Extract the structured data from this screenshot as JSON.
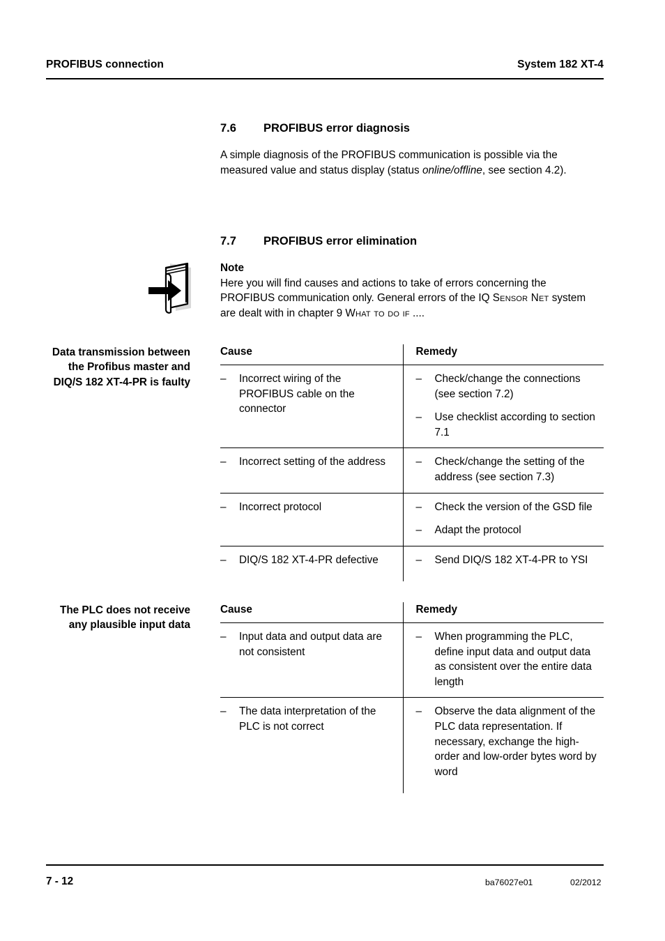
{
  "header": {
    "left": "PROFIBUS connection",
    "right": "System 182 XT-4"
  },
  "sections": {
    "s76": {
      "number": "7.6",
      "title": "PROFIBUS error diagnosis",
      "body_1": "A simple diagnosis of the PROFIBUS communication is possible via the measured value and status display (status ",
      "body_em": "online/offline",
      "body_2": ", see section 4.2)."
    },
    "s77": {
      "number": "7.7",
      "title": "PROFIBUS error elimination"
    }
  },
  "note": {
    "icon": "book-arrow-icon",
    "title": "Note",
    "text_1": "Here you will find causes and actions to take of errors concerning the PROFIBUS communication only. General errors of the IQ ",
    "smallcaps_1": "Sensor Net",
    "text_2": " system are dealt with in chapter 9 ",
    "smallcaps_2": "What to do if",
    "text_3": " ...."
  },
  "tables": [
    {
      "margin_label": "Data transmission between the Profibus master and DIQ/S 182 XT-4-PR is faulty",
      "headers": [
        "Cause",
        "Remedy"
      ],
      "rows": [
        {
          "cause": [
            "Incorrect wiring of the PROFIBUS cable on the connector"
          ],
          "remedy": [
            "Check/change the connections (see section 7.2)",
            "Use checklist according to section 7.1"
          ]
        },
        {
          "cause": [
            "Incorrect setting of the address"
          ],
          "remedy": [
            "Check/change the setting of the address (see section 7.3)"
          ]
        },
        {
          "cause": [
            "Incorrect protocol"
          ],
          "remedy": [
            "Check the version of the GSD file",
            "Adapt the protocol"
          ]
        },
        {
          "cause": [
            "DIQ/S 182 XT-4-PR defective"
          ],
          "remedy": [
            "Send DIQ/S 182 XT-4-PR to YSI"
          ]
        }
      ]
    },
    {
      "margin_label": "The PLC does not receive any plausible input data",
      "headers": [
        "Cause",
        "Remedy"
      ],
      "rows": [
        {
          "cause": [
            "Input data and output data are not consistent"
          ],
          "remedy": [
            "When programming the PLC, define input data and output data as consistent over the entire data length"
          ]
        },
        {
          "cause": [
            "The data interpretation of the PLC is not correct"
          ],
          "remedy": [
            "Observe the data alignment of the PLC data representation. If necessary, exchange the high-order and low-order bytes word by word"
          ]
        }
      ]
    }
  ],
  "footer": {
    "page": "7 - 12",
    "doc_id": "ba76027e01",
    "date": "02/2012"
  },
  "bullet_dash": "–",
  "colors": {
    "text": "#000000",
    "rule": "#000000",
    "page_background": "#ffffff",
    "icon_shadow": "#d4d4d4"
  }
}
